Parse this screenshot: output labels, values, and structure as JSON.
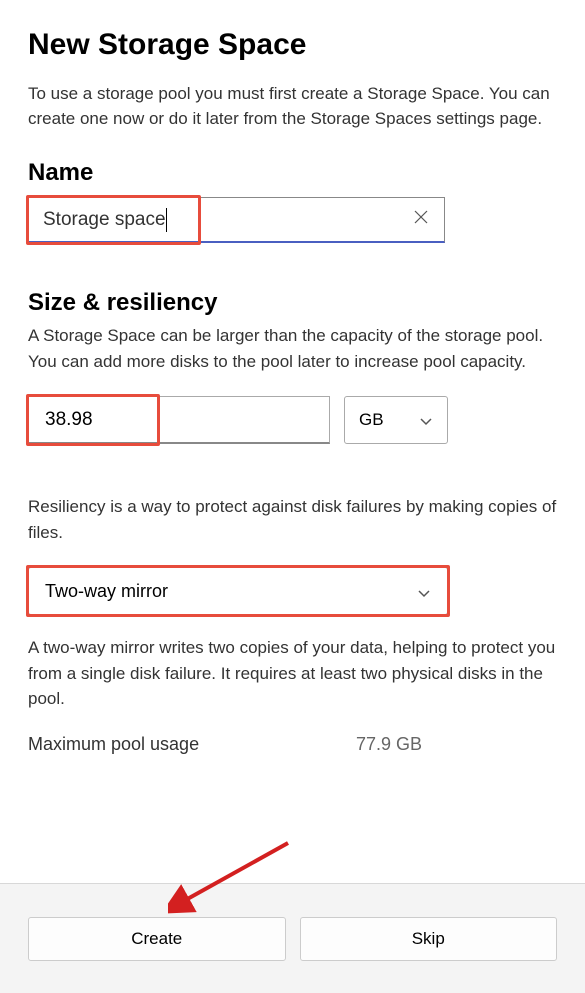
{
  "page": {
    "title": "New Storage Space",
    "intro": "To use a storage pool you must first create a Storage Space. You can create one now or do it later from the Storage Spaces settings page."
  },
  "name_section": {
    "label": "Name",
    "value": "Storage space"
  },
  "size_section": {
    "label": "Size & resiliency",
    "description": "A Storage Space can be larger than the capacity of the storage pool. You can add more disks to the pool later to increase pool capacity.",
    "value": "38.98",
    "unit": "GB"
  },
  "resiliency": {
    "description": "Resiliency is a way to protect against disk failures by making copies of files.",
    "selected": "Two-way mirror",
    "explanation": "A two-way mirror writes two copies of your data, helping to protect you from a single disk failure. It requires at least two physical disks in the pool."
  },
  "usage": {
    "label": "Maximum pool usage",
    "value": "77.9 GB"
  },
  "footer": {
    "create": "Create",
    "skip": "Skip"
  },
  "annotations": {
    "highlight_color": "#e74c3c",
    "arrow_color": "#d32020"
  }
}
